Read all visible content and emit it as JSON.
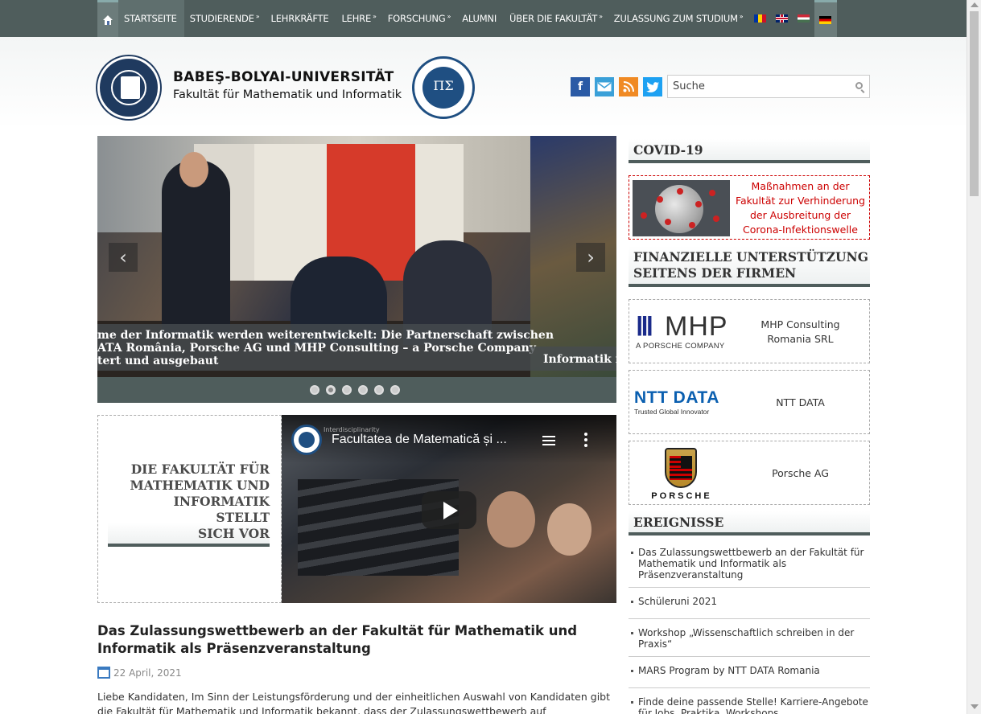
{
  "nav": {
    "items": [
      {
        "label": "STARTSEITE",
        "arrow": ""
      },
      {
        "label": "STUDIERENDE",
        "arrow": "»"
      },
      {
        "label": "LEHRKRÄFTE",
        "arrow": ""
      },
      {
        "label": "LEHRE",
        "arrow": "»"
      },
      {
        "label": "FORSCHUNG",
        "arrow": "»"
      },
      {
        "label": "ALUMNI",
        "arrow": ""
      },
      {
        "label": "ÜBER DIE FAKULTÄT",
        "arrow": "»"
      },
      {
        "label": "ZULASSUNG ZUM STUDIUM",
        "arrow": "»"
      }
    ],
    "flags": [
      "ro-flag-icon",
      "uk-flag-icon",
      "hu-flag-icon",
      "de-flag-icon"
    ]
  },
  "header": {
    "university": "BABEŞ-BOLYAI-UNIVERSITÄT",
    "faculty": "Fakultät für Mathematik und Informatik",
    "search_placeholder": "Suche"
  },
  "social": {
    "facebook": "f",
    "colors": {
      "facebook": "#2a5aa5",
      "mail": "#3aa0d8",
      "rss": "#f08a24",
      "twitter": "#1da1f2"
    }
  },
  "slider": {
    "caption_lines": [
      "me der Informatik werden weiterentwickelt: Die Partnerschaft zwischen",
      "ATA România, Porsche AG und MHP Consulting – a Porsche Company",
      "tert und ausgebaut"
    ],
    "next_caption": "Informatik in",
    "prev": "‹",
    "next": "›",
    "dots": 6,
    "active_dot": 2
  },
  "intro": {
    "lines": [
      "DIE FAKULTÄT FÜR",
      "MATHEMATIK UND",
      "INFORMATIK",
      "STELLT",
      "SICH VOR"
    ]
  },
  "video": {
    "title": "Facultatea de Matematică și ...",
    "channel": "Interdisciplinarity"
  },
  "article": {
    "title": "Das Zulassungswettbewerb an der Fakultät für Mathematik und Informatik als Präsenzveranstaltung",
    "date": "22 April, 2021",
    "body": "Liebe Kandidaten, Im Sinn der Leistungsförderung und der einheitlichen Auswahl von Kandidaten gibt die Fakultät für Mathematik und Informatik bekannt, dass der Zulassungswettbewerb auf Bachelorniveau als"
  },
  "sidebar": {
    "covid_heading": "COVID-19",
    "covid_text": "Maßnahmen an der Fakultät zur Verhinderung der Ausbreitung der Corona-Infektionswelle",
    "sponsors_heading_1": "FINANZIELLE UNTERSTÜTZUNG",
    "sponsors_heading_2": "SEITENS DER FIRMEN",
    "sponsors": [
      {
        "name": "MHP Consulting Romania SRL",
        "logo_mark": "Ⅲ",
        "logo_text": "MHP",
        "logo_sub": "A PORSCHE COMPANY"
      },
      {
        "name": "NTT DATA",
        "logo_text": "NTT DATA",
        "logo_sub": "Trusted Global Innovator"
      },
      {
        "name": "Porsche AG",
        "logo_text": "PORSCHE",
        "crest_text": "PORSCHE"
      }
    ],
    "events_heading": "EREIGNISSE",
    "events": [
      "Das Zulassungswettbewerb an der Fakultät für Mathematik und Informatik als Präsenzveranstaltung",
      "Schüleruni 2021",
      "Workshop „Wissenschaftlich schreiben in der Praxis“",
      "MARS Program by NTT DATA Romania",
      "Finde deine passende Stelle! Karriere-Angebote für Jobs, Praktika, Workshops"
    ]
  }
}
